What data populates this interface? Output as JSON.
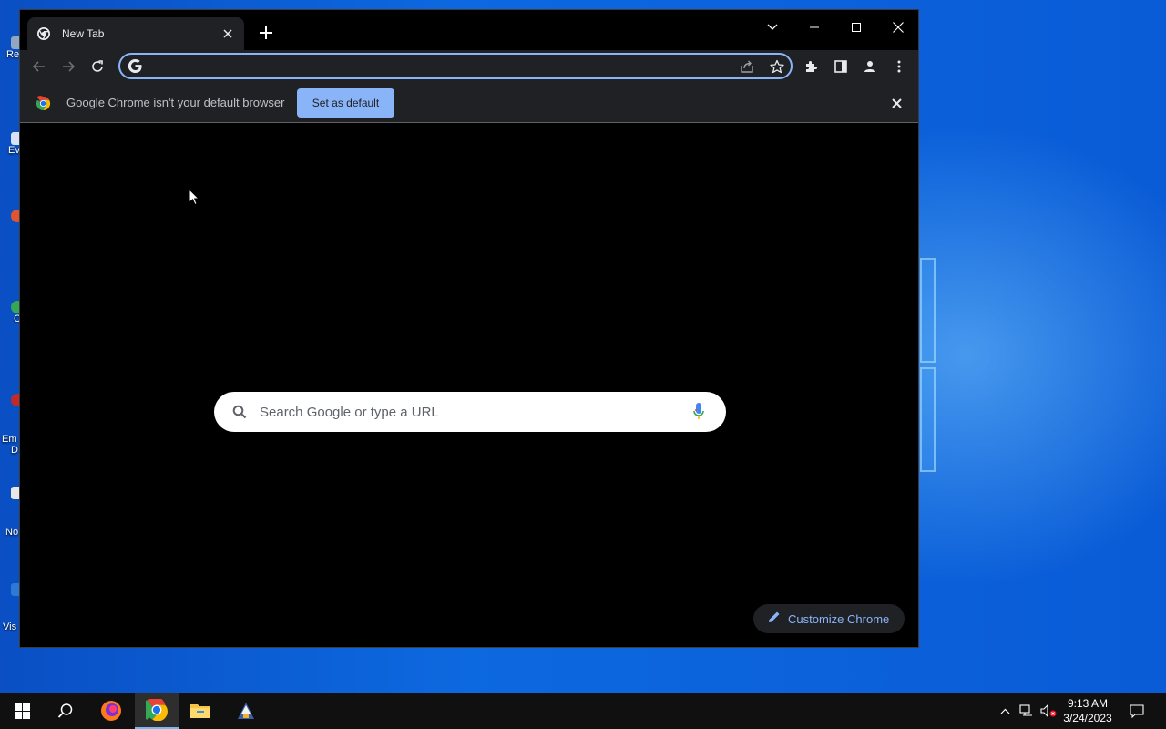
{
  "browser": {
    "tab_title": "New Tab",
    "omnibox_value": "",
    "infobar_message": "Google Chrome isn't your default browser",
    "set_default_label": "Set as default",
    "ntp_search_placeholder": "Search Google or type a URL",
    "customize_label": "Customize Chrome"
  },
  "desktop": {
    "icon_labels": [
      "Re",
      "Ev",
      "C",
      "Em",
      "D",
      "No",
      "Vis"
    ]
  },
  "taskbar": {
    "time": "9:13 AM",
    "date": "3/24/2023"
  },
  "icons": {
    "tab_favicon": "chrome-icon",
    "omnibox": "google-g-icon",
    "search": "search-icon",
    "mic": "mic-icon",
    "customize": "pencil-icon"
  },
  "colors": {
    "accent": "#8ab4f8",
    "toolbar": "#202124",
    "page_background": "#000000",
    "taskbar": "#101010"
  }
}
